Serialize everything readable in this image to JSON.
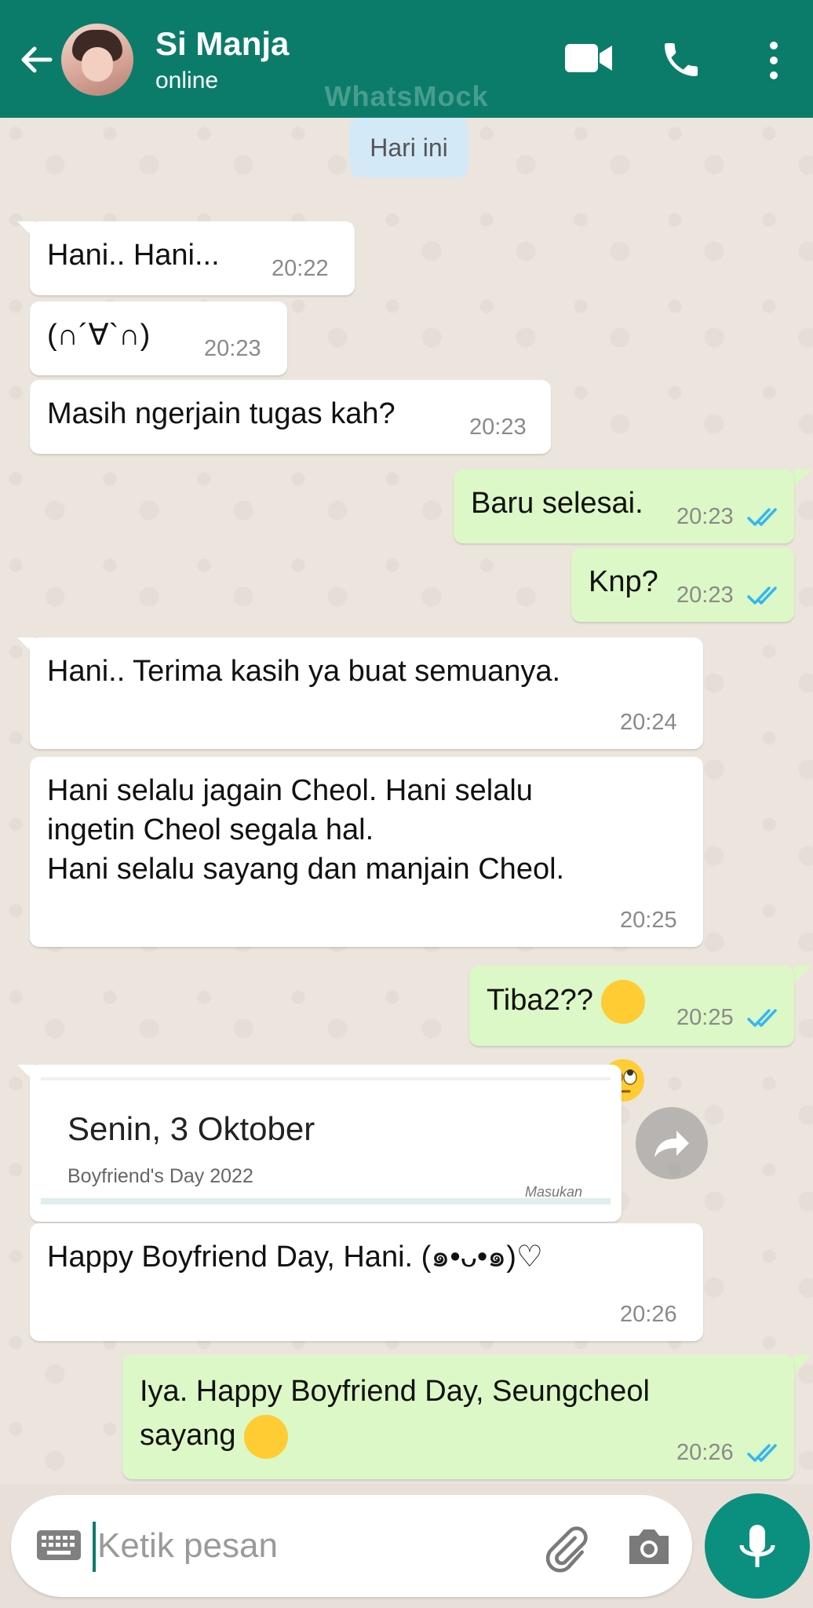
{
  "header": {
    "name": "Si Manja",
    "status": "online",
    "watermark": "WhatsMock"
  },
  "date_chip": "Hari ini",
  "messages": [
    {
      "dir": "in",
      "text": "Hani.. Hani...",
      "time": "20:22"
    },
    {
      "dir": "in",
      "text": "(∩´∀`∩)",
      "time": "20:23"
    },
    {
      "dir": "in",
      "text": "Masih ngerjain tugas kah?",
      "time": "20:23"
    },
    {
      "dir": "out",
      "text": "Baru selesai.",
      "time": "20:23",
      "read": true
    },
    {
      "dir": "out",
      "text": "Knp?",
      "time": "20:23",
      "read": true
    },
    {
      "dir": "in",
      "text": "Hani.. Terima kasih ya buat semuanya.",
      "time": "20:24"
    },
    {
      "dir": "in",
      "text": "Hani selalu jagain Cheol. Hani selalu\ningetin Cheol segala hal.\nHani selalu sayang dan manjain Cheol.",
      "time": "20:25"
    },
    {
      "dir": "out",
      "text": "Tiba2??",
      "time": "20:25",
      "read": true,
      "emoji": "face-with-rolling-eyes"
    },
    {
      "dir": "in",
      "text": "Happy Boyfriend Day, Hani. (๑•ᴗ•๑)♡",
      "time": "20:26"
    },
    {
      "dir": "out",
      "text": "Iya. Happy Boyfriend Day, Seungcheol\nsayang",
      "time": "20:26",
      "read": true,
      "emoji": "face-blowing-a-kiss"
    }
  ],
  "card": {
    "title": "Senin, 3 Oktober",
    "subtitle": "Boyfriend's Day 2022",
    "corner": "Masukan"
  },
  "input": {
    "placeholder": "Ketik pesan"
  },
  "colors": {
    "header": "#0b7c6a",
    "outgoing": "#dcf8c6",
    "incoming": "#ffffff",
    "tick": "#34b7f1",
    "mic": "#0b8f7e"
  }
}
